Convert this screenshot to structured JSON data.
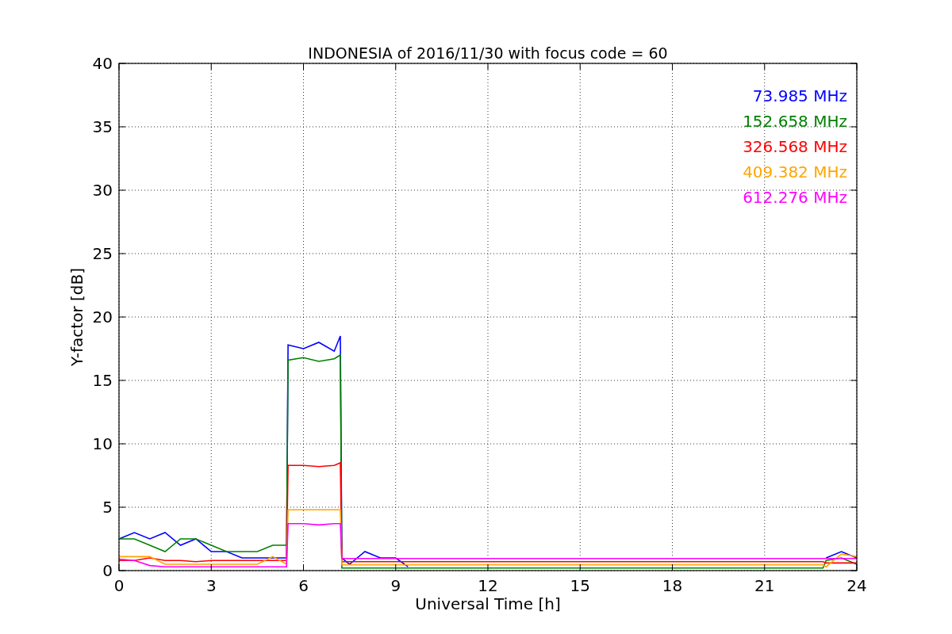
{
  "figure": {
    "chart_data": {
      "type": "line",
      "title": "INDONESIA of 2016/11/30 with focus code = 60",
      "xlabel": "Universal Time [h]",
      "ylabel": "Y-factor [dB]",
      "x": [
        0,
        0.5,
        1,
        1.5,
        2,
        2.5,
        3,
        3.5,
        4,
        4.5,
        5,
        5.45,
        5.5,
        6,
        6.5,
        7,
        7.2,
        7.25,
        7.5,
        8,
        8.5,
        9,
        9.4,
        9.5,
        10,
        12,
        15,
        18,
        21,
        22.9,
        23,
        23.5,
        24
      ],
      "series": [
        {
          "name": "73.985 MHz",
          "color": "#0000ff",
          "values": [
            2.5,
            3,
            2.5,
            3,
            2,
            2.5,
            1.5,
            1.5,
            1,
            1,
            1,
            1,
            17.8,
            17.5,
            18,
            17.3,
            18.5,
            1,
            0.5,
            1.5,
            1,
            1,
            0.3,
            null,
            null,
            null,
            null,
            null,
            null,
            null,
            1,
            1.5,
            1
          ]
        },
        {
          "name": "152.658 MHz",
          "color": "#008000",
          "values": [
            2.5,
            2.5,
            2,
            1.5,
            2.5,
            2.5,
            2,
            1.5,
            1.5,
            1.5,
            2,
            2,
            16.6,
            16.8,
            16.5,
            16.7,
            17,
            0.2,
            0.2,
            0.2,
            0.2,
            0.2,
            0.2,
            0.2,
            0.2,
            0.2,
            0.2,
            0.2,
            0.2,
            0.2,
            0.8,
            1,
            0.5
          ]
        },
        {
          "name": "326.568 MHz",
          "color": "#ff0000",
          "values": [
            0.8,
            0.8,
            1,
            0.8,
            0.8,
            0.7,
            0.8,
            0.8,
            0.8,
            0.8,
            0.8,
            0.8,
            8.3,
            8.3,
            8.2,
            8.3,
            8.5,
            0.7,
            0.7,
            0.7,
            0.7,
            0.7,
            0.7,
            0.7,
            0.7,
            0.7,
            0.7,
            0.7,
            0.7,
            0.7,
            0.6,
            0.6,
            0.6
          ]
        },
        {
          "name": "409.382 MHz",
          "color": "#ffa500",
          "values": [
            1.1,
            1.1,
            1.1,
            0.5,
            0.5,
            0.5,
            0.5,
            0.5,
            0.5,
            0.5,
            1.1,
            0.5,
            4.8,
            4.8,
            4.8,
            4.8,
            4.8,
            0.45,
            0.45,
            0.45,
            0.45,
            0.45,
            0.45,
            0.45,
            0.45,
            0.45,
            0.45,
            0.45,
            0.45,
            0.45,
            0.3,
            1.3,
            1.1
          ]
        },
        {
          "name": "612.276 MHz",
          "color": "#ff00ff",
          "values": [
            0.9,
            0.8,
            0.4,
            0.3,
            0.3,
            0.3,
            0.3,
            0.3,
            0.3,
            0.3,
            0.3,
            0.3,
            3.7,
            3.7,
            3.6,
            3.7,
            3.7,
            0.95,
            0.95,
            0.95,
            0.95,
            0.95,
            0.95,
            0.95,
            0.95,
            0.95,
            0.95,
            0.95,
            0.95,
            0.95,
            0.95,
            0.95,
            0.95
          ]
        }
      ],
      "xlim": [
        0,
        24
      ],
      "ylim": [
        0,
        40
      ],
      "xticks": [
        0,
        3,
        6,
        9,
        12,
        15,
        18,
        21,
        24
      ],
      "yticks": [
        0,
        5,
        10,
        15,
        20,
        25,
        30,
        35,
        40
      ],
      "grid": true
    }
  }
}
